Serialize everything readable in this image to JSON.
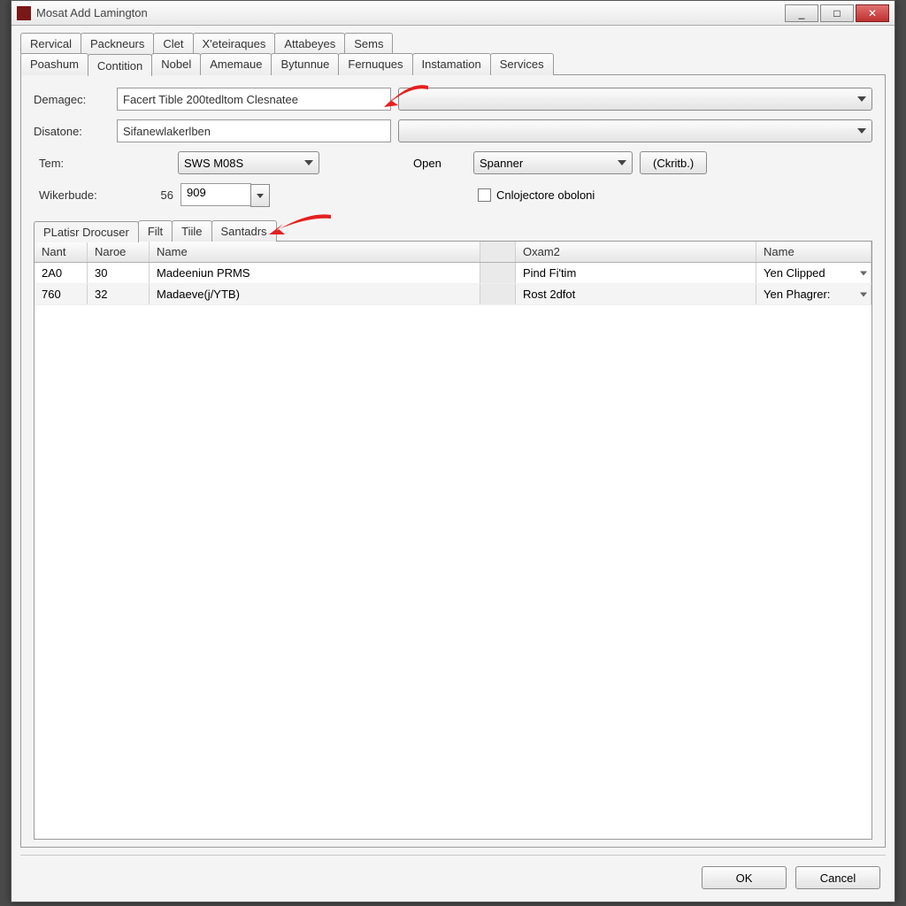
{
  "window": {
    "title": "Mosat Add Lamington"
  },
  "tabs_row1": [
    "Rervical",
    "Packneurs",
    "Clet",
    "X'eteiraques",
    "Attabeyes",
    "Sems"
  ],
  "tabs_row2": [
    "Poashum",
    "Contition",
    "Nobel",
    "Amemaue",
    "Bytunnue",
    "Fernuques",
    "Instamation",
    "Services"
  ],
  "active_tab": "Contition",
  "form": {
    "demagec_label": "Demagec:",
    "demagec_value": "Facert Tible 200tedltom Clesnatee",
    "disatone_label": "Disatone:",
    "disatone_value": "Sifanewlakerlben",
    "tem_label": "Tem:",
    "tem_value": "SWS M08S",
    "open_label": "Open",
    "open_value": "Spanner",
    "button_ckritb": "(Ckritb.)",
    "wikerbude_label": "Wikerbude:",
    "wikerbude_num": "56",
    "wikerbude_spin": "909",
    "checkbox_label": "Cnlojectore oboloni"
  },
  "subtabs": [
    "PLatisr Drocuser",
    "Filt",
    "Tiile",
    "Santadrs"
  ],
  "active_subtab": "PLatisr Drocuser",
  "grid": {
    "headers": [
      "Nant",
      "Naroe",
      "Name",
      "Oxam2",
      "Name"
    ],
    "rows": [
      {
        "c1": "2A0",
        "c2": "30",
        "c3": "Madeeniun PRMS",
        "c5": "Pind Fi'tim",
        "c6": "Yen Clipped"
      },
      {
        "c1": "760",
        "c2": "32",
        "c3": "Madaeve(j/YTB)",
        "c5": "Rost 2dfot",
        "c6": "Yen Phagrer:"
      }
    ]
  },
  "footer": {
    "ok": "OK",
    "cancel": "Cancel"
  },
  "annotations": {
    "arrow1": "red-arrow-pointing-left",
    "arrow2": "red-arrow-pointing-left"
  }
}
